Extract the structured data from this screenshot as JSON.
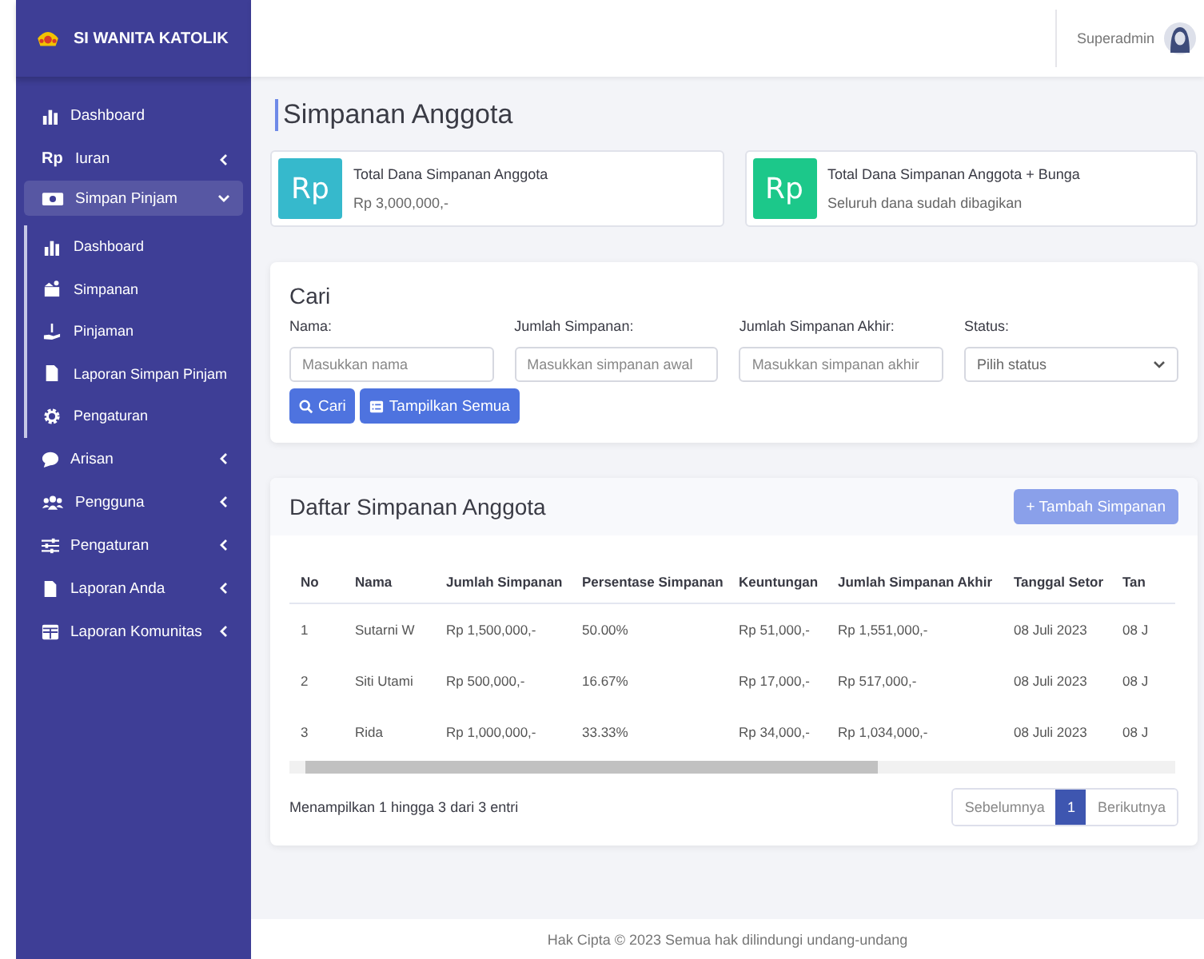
{
  "sidebar": {
    "brand": "SI WANITA KATOLIK",
    "items": [
      {
        "label": "Dashboard"
      },
      {
        "label": "Iuran",
        "icon_text": "Rp",
        "expanded": false
      },
      {
        "label": "Simpan Pinjam",
        "expanded": true,
        "children": [
          {
            "label": "Dashboard"
          },
          {
            "label": "Simpanan"
          },
          {
            "label": "Pinjaman"
          },
          {
            "label": "Laporan Simpan Pinjam"
          },
          {
            "label": "Pengaturan"
          }
        ]
      },
      {
        "label": "Arisan",
        "expanded": false
      },
      {
        "label": "Pengguna",
        "expanded": false
      },
      {
        "label": "Pengaturan",
        "expanded": false
      },
      {
        "label": "Laporan Anda",
        "expanded": false
      },
      {
        "label": "Laporan Komunitas",
        "expanded": false
      }
    ]
  },
  "topbar": {
    "user": "Superadmin"
  },
  "page_title": "Simpanan Anggota",
  "stats": [
    {
      "icon_text": "Rp",
      "color": "#36b9cc",
      "title": "Total Dana Simpanan Anggota",
      "value": "Rp 3,000,000,-"
    },
    {
      "icon_text": "Rp",
      "color": "#1cc88a",
      "title": "Total Dana Simpanan Anggota + Bunga",
      "value": "Seluruh dana sudah dibagikan"
    }
  ],
  "search": {
    "title": "Cari",
    "fields": [
      {
        "label": "Nama:",
        "placeholder": "Masukkan nama",
        "kind": "input"
      },
      {
        "label": "Jumlah Simpanan:",
        "placeholder": "Masukkan simpanan awal",
        "kind": "input"
      },
      {
        "label": "Jumlah Simpanan Akhir:",
        "placeholder": "Masukkan simpanan akhir",
        "kind": "input"
      },
      {
        "label": "Status:",
        "placeholder": "Pilih status",
        "kind": "select"
      }
    ],
    "buttons": [
      "Cari",
      "Tampilkan Semua"
    ]
  },
  "table": {
    "title": "Daftar Simpanan Anggota",
    "add_button": "+ Tambah Simpanan",
    "columns": [
      "No",
      "Nama",
      "Jumlah Simpanan",
      "Persentase Simpanan",
      "Keuntungan",
      "Jumlah Simpanan Akhir",
      "Tanggal Setor",
      "Tan"
    ],
    "rows": [
      [
        "1",
        "Sutarni W",
        "Rp 1,500,000,-",
        "50.00%",
        "Rp 51,000,-",
        "Rp 1,551,000,-",
        "08 Juli 2023",
        "08 J"
      ],
      [
        "2",
        "Siti Utami",
        "Rp 500,000,-",
        "16.67%",
        "Rp 17,000,-",
        "Rp 517,000,-",
        "08 Juli 2023",
        "08 J"
      ],
      [
        "3",
        "Rida",
        "Rp 1,000,000,-",
        "33.33%",
        "Rp 34,000,-",
        "Rp 1,034,000,-",
        "08 Juli 2023",
        "08 J"
      ]
    ],
    "info": "Menampilkan 1 hingga 3 dari 3 entri",
    "pagination": [
      {
        "label": "Sebelumnya",
        "selected": false
      },
      {
        "label": "1",
        "selected": true
      },
      {
        "label": "Berikutnya",
        "selected": false
      }
    ]
  },
  "footer": "Hak Cipta © 2023 Semua hak dilindungi undang-undang"
}
